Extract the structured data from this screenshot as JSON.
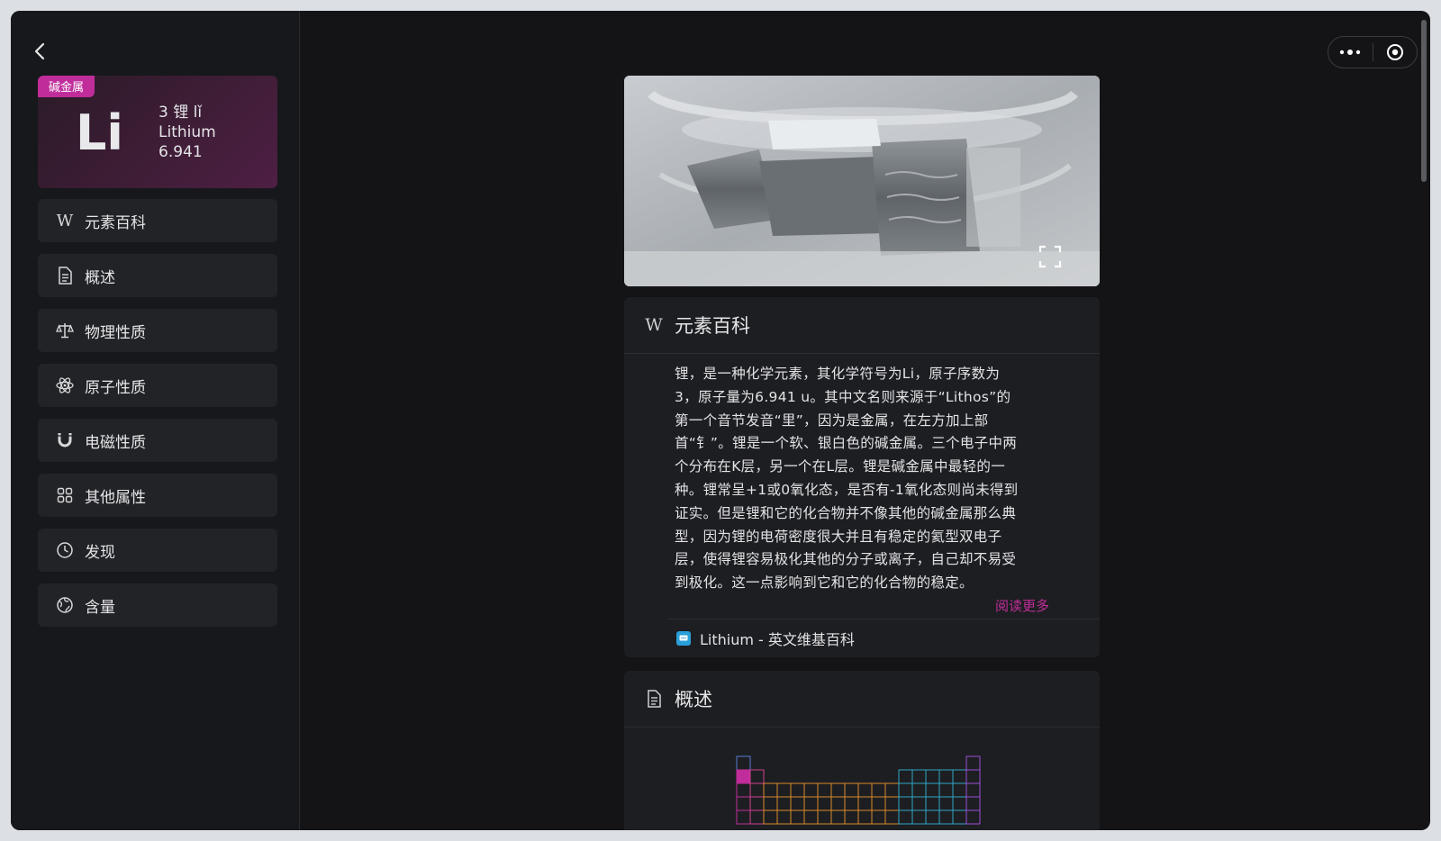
{
  "element": {
    "category": "碱金属",
    "symbol": "Li",
    "number_name": "3 锂 lǐ",
    "english_name": "Lithium",
    "mass": "6.941"
  },
  "sidebar": {
    "items": [
      {
        "label": "元素百科",
        "icon": "wikipedia-icon"
      },
      {
        "label": "概述",
        "icon": "document-icon"
      },
      {
        "label": "物理性质",
        "icon": "scale-icon"
      },
      {
        "label": "原子性质",
        "icon": "atom-icon"
      },
      {
        "label": "电磁性质",
        "icon": "magnet-icon"
      },
      {
        "label": "其他属性",
        "icon": "grid-icon"
      },
      {
        "label": "发现",
        "icon": "clock-icon"
      },
      {
        "label": "含量",
        "icon": "globe-icon"
      }
    ]
  },
  "wiki_card": {
    "title": "元素百科",
    "lines": [
      "锂，是一种化学元素，其化学符号为Li，原子序数为",
      "3，原子量为6.941 u。其中文名则来源于“Lithos”的",
      "第一个音节发音“里”，因为是金属，在左方加上部",
      "首“钅”。锂是一个软、银白色的碱金属。三个电子中两",
      "个分布在K层，另一个在L层。锂是碱金属中最轻的一",
      "种。锂常呈+1或0氧化态，是否有-1氧化态则尚未得到",
      "证实。但是锂和它的化合物并不像其他的碱金属那么典",
      "型，因为锂的电荷密度很大并且有稳定的氦型双电子",
      "层，使得锂容易极化其他的分子或离子，自己却不易受",
      "到极化。这一点影响到它和它的化合物的稳定。"
    ],
    "read_more": "阅读更多",
    "source_link": "Lithium - 英文维基百科"
  },
  "overview_card": {
    "title": "概述"
  },
  "colors": {
    "accent": "#c02d9b",
    "background": "#141416",
    "card": "#1d1e21"
  }
}
